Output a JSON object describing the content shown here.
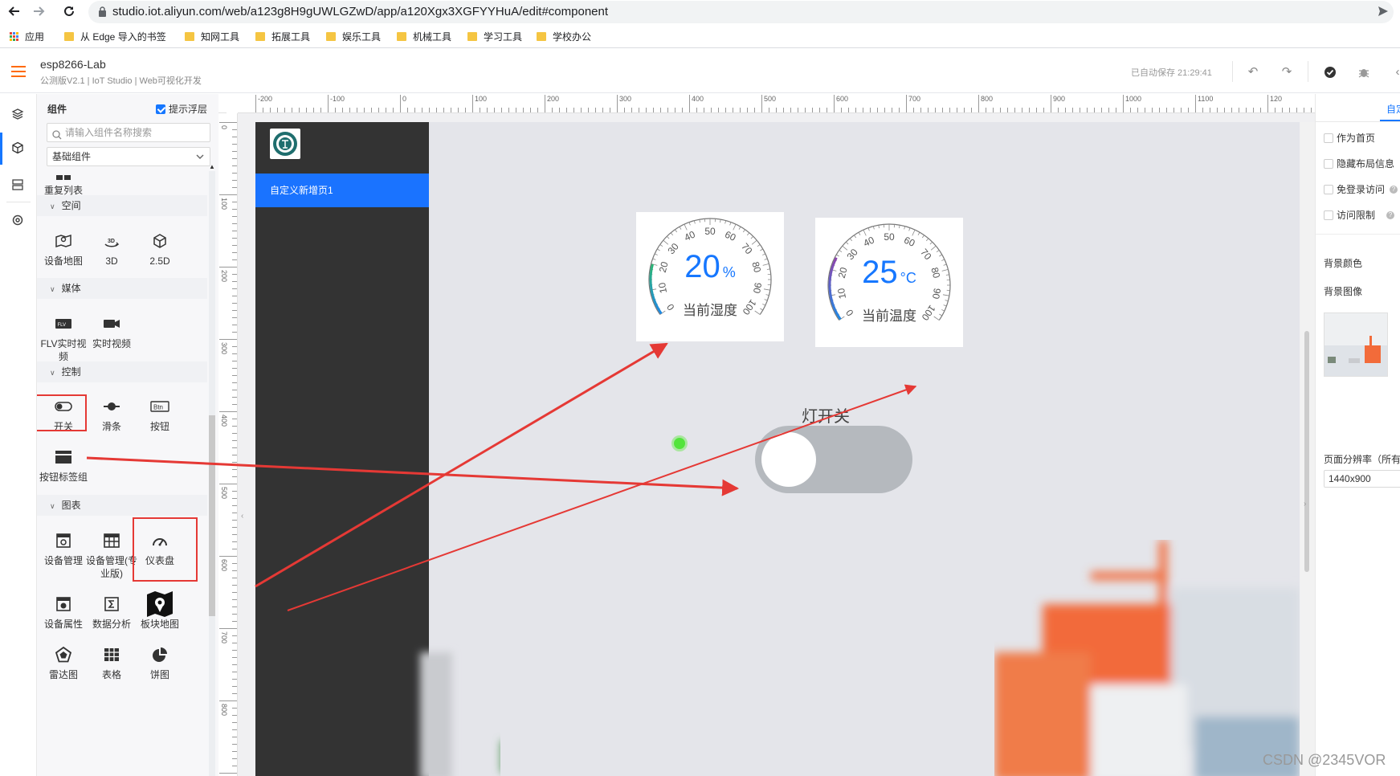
{
  "browser": {
    "url": "studio.iot.aliyun.com/web/a123g8H9gUWLGZwD/app/a120Xgx3XGFYYHuA/edit#component",
    "bookmarks": [
      {
        "label": "应用",
        "kind": "apps"
      },
      {
        "label": "从 Edge 导入的书签",
        "kind": "folder"
      },
      {
        "label": "知网工具",
        "kind": "folder"
      },
      {
        "label": "拓展工具",
        "kind": "folder"
      },
      {
        "label": "娱乐工具",
        "kind": "folder"
      },
      {
        "label": "机械工具",
        "kind": "folder"
      },
      {
        "label": "学习工具",
        "kind": "folder"
      },
      {
        "label": "学校办公",
        "kind": "folder"
      }
    ]
  },
  "header": {
    "project_name": "esp8266-Lab",
    "subtitle": "公测版V2.1 | IoT Studio | Web可视化开发",
    "autosave": "已自动保存 21:29:41"
  },
  "panel": {
    "title": "组件",
    "hint_label": "提示浮层",
    "hint_checked": true,
    "search_placeholder": "请输入组件名称搜索",
    "select_value": "基础组件",
    "top_item": "重复列表",
    "sections": {
      "space": {
        "title": "空间",
        "items": [
          "设备地图",
          "3D",
          "2.5D"
        ]
      },
      "media": {
        "title": "媒体",
        "items": [
          "FLV实时视频",
          "实时视频"
        ]
      },
      "control": {
        "title": "控制",
        "items": [
          "开关",
          "滑条",
          "按钮",
          "按钮标签组"
        ]
      },
      "chart": {
        "title": "图表",
        "items": [
          "设备管理",
          "设备管理(专业版)",
          "仪表盘",
          "设备属性",
          "数据分析",
          "板块地图",
          "雷达图",
          "表格",
          "饼图"
        ]
      }
    }
  },
  "canvas": {
    "ruler_h": [
      "-200",
      "-100",
      "0",
      "100",
      "200",
      "300",
      "400",
      "500",
      "600",
      "700",
      "800",
      "900",
      "1000",
      "1100",
      "120"
    ],
    "ruler_v": [
      "0",
      "100",
      "200",
      "300",
      "400",
      "500",
      "600",
      "700",
      "800"
    ],
    "nav_item": "自定义新增页1",
    "gauges": [
      {
        "value": "20",
        "unit": "%",
        "label": "当前湿度",
        "percent": 20,
        "arc_color_start": "#2bb673",
        "arc_color_end": "#1e88e5"
      },
      {
        "value": "25",
        "unit": "°C",
        "label": "当前温度",
        "percent": 25,
        "arc_color_start": "#8e44ad",
        "arc_color_end": "#1e88e5"
      }
    ],
    "gauge_ticks": [
      "0",
      "10",
      "20",
      "30",
      "40",
      "50",
      "60",
      "70",
      "80",
      "90",
      "100"
    ],
    "switch_label": "灯开关",
    "switch_on": false
  },
  "right_panel": {
    "tab": "自定",
    "options": [
      {
        "label": "作为首页",
        "checked": false
      },
      {
        "label": "隐藏布局信息",
        "checked": false
      },
      {
        "label": "免登录访问",
        "checked": false
      },
      {
        "label": "访问限制",
        "checked": false
      }
    ],
    "bg_color_label": "背景颜色",
    "bg_image_label": "背景图像",
    "resolution_label": "页面分辨率（所有",
    "resolution_value": "1440x900"
  },
  "watermark": "CSDN @2345VOR",
  "colors": {
    "accent": "#1677ff",
    "annotation_red": "#e53935",
    "nav_bg": "#333333"
  }
}
